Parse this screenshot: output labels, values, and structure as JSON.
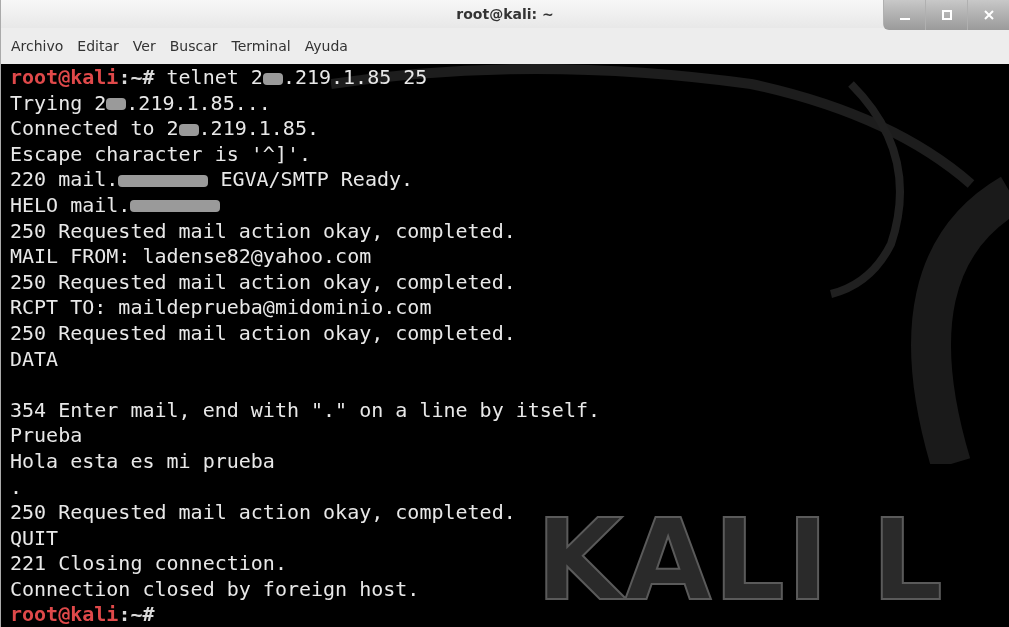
{
  "window": {
    "title": "root@kali: ~"
  },
  "menu": [
    "Archivo",
    "Editar",
    "Ver",
    "Buscar",
    "Terminal",
    "Ayuda"
  ],
  "backdrop": {
    "logo_text": "KALI L"
  },
  "terminal": {
    "lines": [
      [
        {
          "kind": "prompt",
          "user": "root@kali",
          "path": ":~#"
        },
        {
          "kind": "text",
          "text": " telnet 2"
        },
        {
          "kind": "redacted_short"
        },
        {
          "kind": "text",
          "text": ".219.1.85 25"
        }
      ],
      [
        {
          "kind": "text",
          "text": "Trying 2"
        },
        {
          "kind": "redacted_short"
        },
        {
          "kind": "text",
          "text": ".219.1.85..."
        }
      ],
      [
        {
          "kind": "text",
          "text": "Connected to 2"
        },
        {
          "kind": "redacted_short"
        },
        {
          "kind": "text",
          "text": ".219.1.85."
        }
      ],
      [
        {
          "kind": "text",
          "text": "Escape character is '^]'."
        }
      ],
      [
        {
          "kind": "text",
          "text": "220 mail."
        },
        {
          "kind": "redacted_long"
        },
        {
          "kind": "text",
          "text": " EGVA/SMTP Ready."
        }
      ],
      [
        {
          "kind": "text",
          "text": "HELO mail."
        },
        {
          "kind": "redacted_long"
        }
      ],
      [
        {
          "kind": "text",
          "text": "250 Requested mail action okay, completed."
        }
      ],
      [
        {
          "kind": "text",
          "text": "MAIL FROM: ladense82@yahoo.com"
        }
      ],
      [
        {
          "kind": "text",
          "text": "250 Requested mail action okay, completed."
        }
      ],
      [
        {
          "kind": "text",
          "text": "RCPT TO: maildeprueba@midominio.com"
        }
      ],
      [
        {
          "kind": "text",
          "text": "250 Requested mail action okay, completed."
        }
      ],
      [
        {
          "kind": "text",
          "text": "DATA"
        }
      ],
      [
        {
          "kind": "blank"
        }
      ],
      [
        {
          "kind": "text",
          "text": "354 Enter mail, end with \".\" on a line by itself."
        }
      ],
      [
        {
          "kind": "text",
          "text": "Prueba"
        }
      ],
      [
        {
          "kind": "text",
          "text": "Hola esta es mi prueba"
        }
      ],
      [
        {
          "kind": "text",
          "text": "."
        }
      ],
      [
        {
          "kind": "text",
          "text": "250 Requested mail action okay, completed."
        }
      ],
      [
        {
          "kind": "text",
          "text": "QUIT"
        }
      ],
      [
        {
          "kind": "text",
          "text": "221 Closing connection."
        }
      ],
      [
        {
          "kind": "text",
          "text": "Connection closed by foreign host."
        }
      ],
      [
        {
          "kind": "prompt",
          "user": "root@kali",
          "path": ":~#"
        }
      ]
    ]
  }
}
